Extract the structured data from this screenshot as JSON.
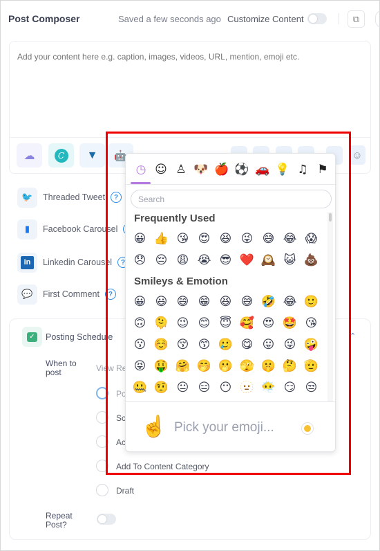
{
  "header": {
    "title": "Post Composer",
    "saved_status": "Saved a few seconds ago",
    "customize_label": "Customize Content",
    "customize_enabled": false,
    "copy_icon": "copy-icon"
  },
  "editor": {
    "placeholder": "Add your content here e.g. caption, images, videos, URL, mention, emoji etc.",
    "value": "",
    "toolbar": [
      {
        "name": "upload-media",
        "icon": "cloud-upload-icon"
      },
      {
        "name": "canva",
        "icon": "canva-icon",
        "glyph": "C"
      },
      {
        "name": "vista-create",
        "icon": "vista-icon"
      },
      {
        "name": "ai-assistant",
        "icon": "robot-icon"
      },
      {
        "name": "emoji",
        "icon": "smiley-icon"
      }
    ]
  },
  "options": [
    {
      "label": "Threaded Tweet",
      "icon": "twitter-icon"
    },
    {
      "label": "Facebook Carousel",
      "icon": "carousel-icon"
    },
    {
      "label": "Linkedin Carousel",
      "icon": "linkedin-icon",
      "glyph": "in"
    },
    {
      "label": "First Comment",
      "icon": "comment-icon"
    }
  ],
  "help_glyph": "?",
  "schedule": {
    "title": "Posting Schedule",
    "when_label": "When to post",
    "view_label": "View Re",
    "choices": [
      {
        "label": "Po",
        "selected": true
      },
      {
        "label": "Sc",
        "selected": false
      },
      {
        "label": "Ac",
        "selected": false
      },
      {
        "label": "Add To Content Category",
        "selected": false
      },
      {
        "label": "Draft",
        "selected": false
      }
    ],
    "repeat_label": "Repeat Post?",
    "repeat_enabled": false
  },
  "emoji_picker": {
    "categories": [
      {
        "name": "frequently-used",
        "glyph": "◷",
        "active": true
      },
      {
        "name": "smileys",
        "glyph": "☺"
      },
      {
        "name": "people",
        "glyph": "♙"
      },
      {
        "name": "animals",
        "glyph": "🐶"
      },
      {
        "name": "food",
        "glyph": "🍎"
      },
      {
        "name": "activities",
        "glyph": "⚽"
      },
      {
        "name": "travel",
        "glyph": "🚗"
      },
      {
        "name": "objects",
        "glyph": "💡"
      },
      {
        "name": "symbols",
        "glyph": "♫"
      },
      {
        "name": "flags",
        "glyph": "⚑"
      }
    ],
    "search_placeholder": "Search",
    "sections": [
      {
        "title": "Frequently Used",
        "emojis": [
          "😀",
          "👍",
          "😘",
          "😍",
          "😆",
          "😜",
          "😅",
          "😂",
          "😱",
          "😞",
          "😔",
          "😩",
          "😭",
          "😎",
          "❤️",
          "🕰️",
          "😺",
          "💩"
        ]
      },
      {
        "title": "Smileys & Emotion",
        "emojis": [
          "😀",
          "😃",
          "😄",
          "😁",
          "😆",
          "😅",
          "🤣",
          "😂",
          "🙂",
          "🙃",
          "🫠",
          "😉",
          "😊",
          "😇",
          "🥰",
          "😍",
          "🤩",
          "😘",
          "😗",
          "☺️",
          "😚",
          "😙",
          "🥲",
          "😋",
          "😛",
          "😜",
          "🤪",
          "😝",
          "🤑",
          "🤗",
          "🤭",
          "🫢",
          "🫣",
          "🤫",
          "🤔",
          "🫡",
          "🤐",
          "🤨",
          "😐",
          "😑",
          "😶",
          "🫥",
          "😶‍🌫️",
          "😏",
          "😒"
        ]
      }
    ],
    "preview_emoji": "☝️",
    "preview_text": "Pick your emoji...",
    "skin_tone_color": "#f7c131"
  },
  "colors": {
    "accent_purple": "#b57be0",
    "highlight_red": "#ee0000",
    "link_blue": "#2e8de6"
  }
}
